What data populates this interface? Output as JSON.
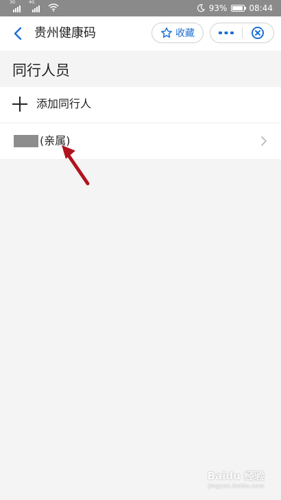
{
  "status_bar": {
    "signal_1_label": "3G",
    "signal_2_label": "4G",
    "battery_text": "93%",
    "battery_level": 0.93,
    "time": "08:44"
  },
  "navbar": {
    "title": "贵州健康码",
    "favorite_label": "收藏"
  },
  "section": {
    "title": "同行人员"
  },
  "list": {
    "add_label": "添加同行人",
    "person_relation": "(亲属)"
  },
  "colors": {
    "accent": "#1a6fd6",
    "annotation": "#b0141e",
    "status_bar_bg": "#8a8a8a"
  },
  "watermark": {
    "brand": "Baidu 经验",
    "url": "jingyan.baidu.com"
  }
}
